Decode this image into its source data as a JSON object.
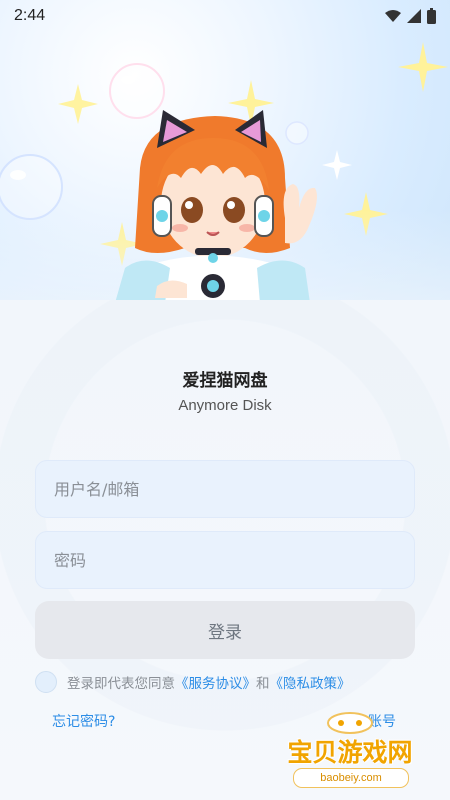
{
  "status_bar": {
    "time": "2:44"
  },
  "app": {
    "name": "爱捏猫网盘",
    "subtitle": "Anymore Disk"
  },
  "form": {
    "username_placeholder": "用户名/邮箱",
    "password_placeholder": "密码",
    "login_label": "登录"
  },
  "agreement": {
    "prefix": "登录即代表您同意",
    "service_link": "《服务协议》",
    "conjunction": "和",
    "privacy_link": "《隐私政策》"
  },
  "links": {
    "forgot_password": "忘记密码?",
    "register": "注册账号"
  },
  "watermark": {
    "title": "宝贝游戏网",
    "url": "baobeiy.com"
  },
  "colors": {
    "accent": "#2c8de6",
    "field_bg": "#e9f2fd",
    "button_bg": "#e6e8ed"
  }
}
